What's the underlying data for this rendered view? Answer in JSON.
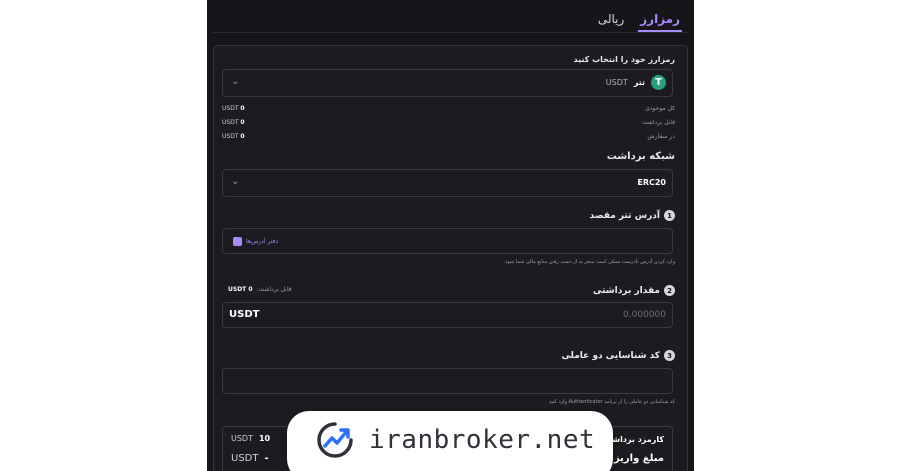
{
  "tabs": [
    {
      "label": "رمزارز",
      "active": true
    },
    {
      "label": "ریالی",
      "active": false
    }
  ],
  "select_crypto": {
    "label": "رمزارز خود را انتخاب کنید",
    "name": "تتر",
    "symbol": "USDT"
  },
  "balances": [
    {
      "label": "کل موجودی",
      "value": "0",
      "unit": "USDT"
    },
    {
      "label": "قابل برداشت",
      "value": "0",
      "unit": "USDT"
    },
    {
      "label": "در سفارش",
      "value": "0",
      "unit": "USDT"
    }
  ],
  "network": {
    "label": "شبکه برداشت",
    "value": "ERC20"
  },
  "address": {
    "step": "1",
    "label": "آدرس تتر مقصد",
    "book_label": "دفتر آدرس‌ها",
    "hint": "وارد کردن آدرس نادرست ممکن است منجر به از دست رفتن منابع مالی شما شود."
  },
  "amount": {
    "step": "2",
    "label": "مقدار برداشتی",
    "withdrawable_label": "قابل برداشت:",
    "withdrawable_value": "0 USDT",
    "unit": "USDT",
    "placeholder": "0.000000"
  },
  "twofa": {
    "step": "3",
    "label": "کد شناسایی دو عاملی",
    "hint": "کد شناسایی دو عاملی را از برنامه Authenticator وارد کنید"
  },
  "fee": {
    "label": "کارمزد برداشت",
    "value": "10",
    "unit": "USDT",
    "deposit_label": "مبلغ واریز بخ",
    "deposit_value": "-",
    "deposit_unit": "USDT"
  },
  "watermark": {
    "text": "iranbroker.net"
  },
  "colors": {
    "accent": "#a78bfa",
    "tether": "#26a17b",
    "background": "#16161a"
  }
}
